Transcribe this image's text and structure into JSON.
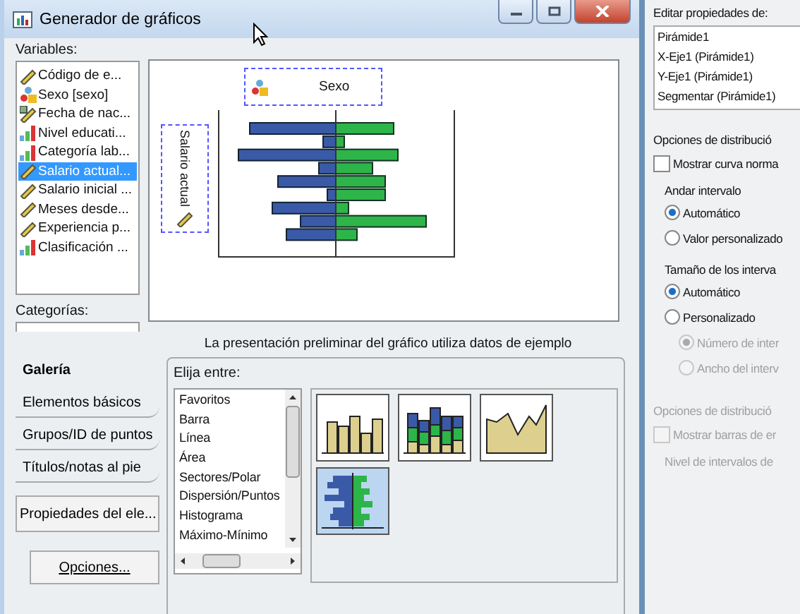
{
  "window": {
    "title": "Generador de gráficos"
  },
  "variables": {
    "label": "Variables:",
    "items": [
      {
        "name": "Código de e...",
        "kind": "scale",
        "selected": false
      },
      {
        "name": "Sexo [sexo]",
        "kind": "nominal",
        "selected": false
      },
      {
        "name": "Fecha de nac...",
        "kind": "date",
        "selected": false
      },
      {
        "name": "Nivel educati...",
        "kind": "ordinal",
        "selected": false
      },
      {
        "name": "Categoría lab...",
        "kind": "ordinal",
        "selected": false
      },
      {
        "name": "Salario actual...",
        "kind": "scale",
        "selected": true
      },
      {
        "name": "Salario inicial ...",
        "kind": "scale",
        "selected": false
      },
      {
        "name": "Meses desde...",
        "kind": "scale",
        "selected": false
      },
      {
        "name": "Experiencia p...",
        "kind": "scale",
        "selected": false
      },
      {
        "name": "Clasificación ...",
        "kind": "ordinal",
        "selected": false
      }
    ]
  },
  "categories": {
    "label": "Categorías:"
  },
  "preview": {
    "x_zone": "Sexo",
    "y_zone": "Salario actual",
    "caption": "La presentación preliminar del gráfico utiliza datos de ejemplo"
  },
  "tabs": [
    {
      "label": "Galería",
      "selected": true
    },
    {
      "label": "Elementos básicos",
      "selected": false
    },
    {
      "label": "Grupos/ID de puntos",
      "selected": false
    },
    {
      "label": "Títulos/notas al pie",
      "selected": false
    }
  ],
  "buttons": [
    "Propiedades del ele...",
    "Opciones..."
  ],
  "gallery": {
    "label": "Elija entre:",
    "types": [
      "Favoritos",
      "Barra",
      "Línea",
      "Área",
      "Sectores/Polar",
      "Dispersión/Puntos",
      "Histograma",
      "Máximo-Mínimo"
    ],
    "thumbnails": [
      {
        "kind": "bar",
        "selected": false
      },
      {
        "kind": "stacked-bar",
        "selected": false
      },
      {
        "kind": "area",
        "selected": false
      },
      {
        "kind": "pyramid",
        "selected": true
      }
    ]
  },
  "properties": {
    "label": "Editar propiedades de:",
    "items": [
      "Pirámide1",
      "X-Eje1 (Pirámide1)",
      "Y-Eje1 (Pirámide1)",
      "Segmentar (Pirámide1)"
    ],
    "options": [
      {
        "kind": "heading",
        "label": "Opciones de distribució",
        "disabled": false
      },
      {
        "kind": "checkbox",
        "label": "Mostrar curva norma",
        "checked": false,
        "disabled": false
      },
      {
        "kind": "subheading",
        "label": "Andar intervalo",
        "disabled": false
      },
      {
        "kind": "radio",
        "label": "Automático",
        "selected": true,
        "disabled": false
      },
      {
        "kind": "radio",
        "label": "Valor personalizado",
        "selected": false,
        "disabled": false
      },
      {
        "kind": "subheading",
        "label": "Tamaño de los interva",
        "disabled": false
      },
      {
        "kind": "radio",
        "label": "Automático",
        "selected": true,
        "disabled": false
      },
      {
        "kind": "radio",
        "label": "Personalizado",
        "selected": false,
        "disabled": false,
        "children": [
          {
            "kind": "radio",
            "label": "Número de inter",
            "selected": true,
            "disabled": true
          },
          {
            "kind": "radio",
            "label": "Ancho del interv",
            "selected": false,
            "disabled": true
          }
        ]
      },
      {
        "kind": "heading",
        "label": "Opciones de distribució",
        "disabled": true
      },
      {
        "kind": "checkbox",
        "label": "Mostrar barras de er",
        "checked": false,
        "disabled": true
      },
      {
        "kind": "subheading",
        "label": "Nivel de intervalos de",
        "disabled": true
      }
    ]
  }
}
